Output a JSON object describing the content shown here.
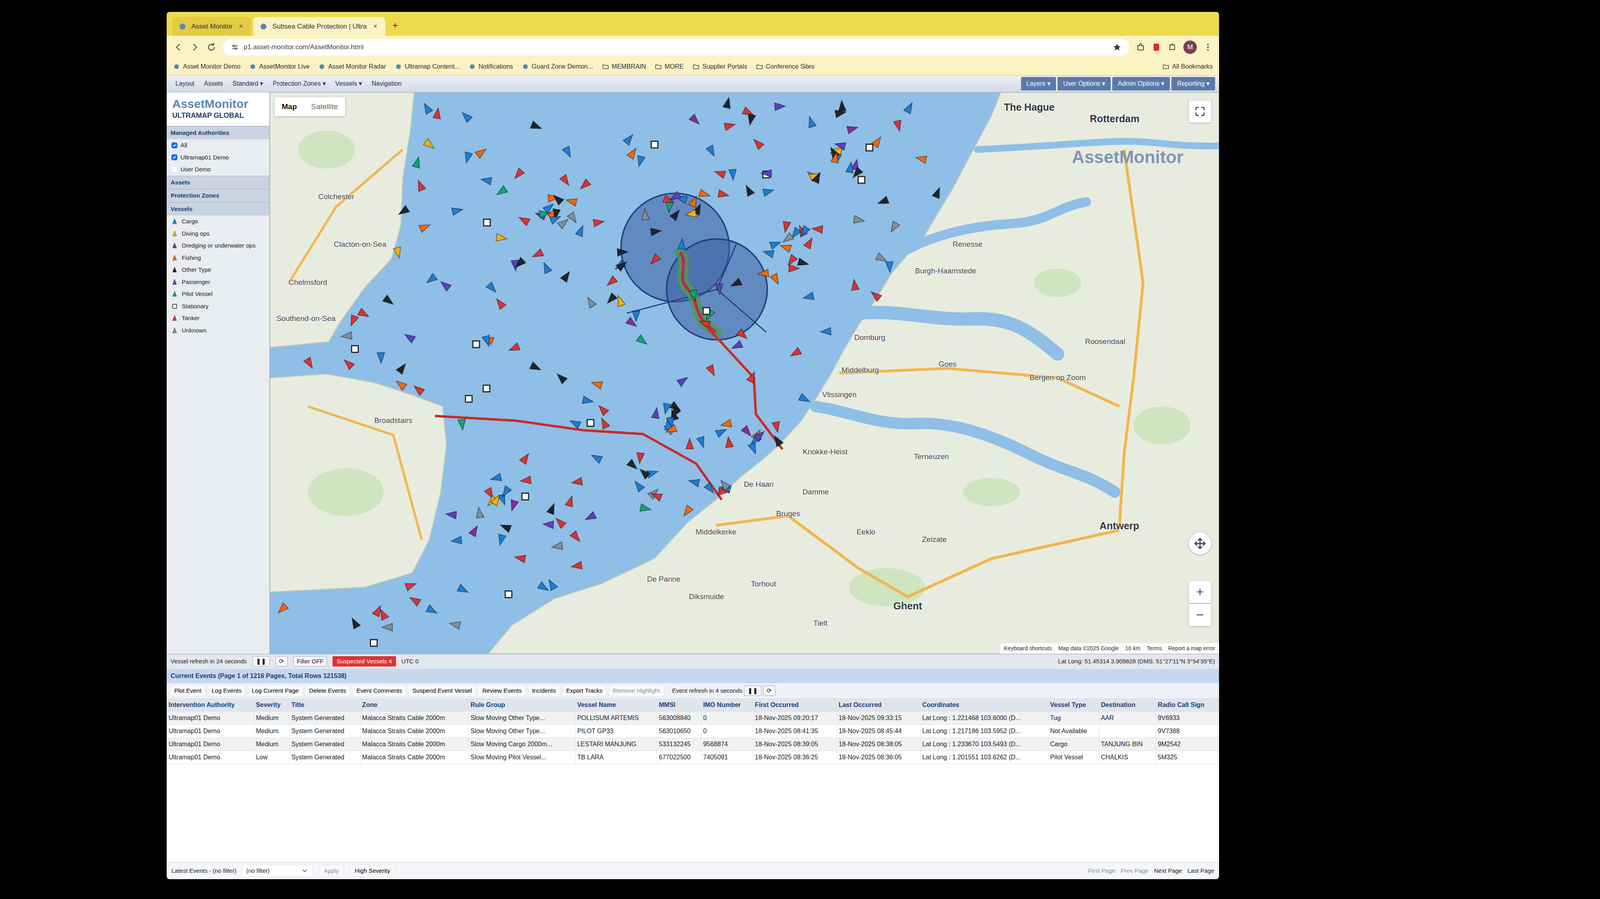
{
  "browser": {
    "tabs": [
      {
        "label": "Asset Monitor",
        "close": "×",
        "selected": false
      },
      {
        "label": "Subsea Cable Protection | Ultra",
        "close": "×",
        "selected": true
      }
    ],
    "new_tab": "+",
    "url": "p1.asset-monitor.com/AssetMonitor.html",
    "profile": "M",
    "bookmarks": [
      {
        "label": "Asset Monitor Demo",
        "kind": "site"
      },
      {
        "label": "AssetMonitor Live",
        "kind": "site"
      },
      {
        "label": "Asset Monitor Radar",
        "kind": "site"
      },
      {
        "label": "Ultramap Content...",
        "kind": "site"
      },
      {
        "label": "Notifications",
        "kind": "site"
      },
      {
        "label": "Guard Zone Demon...",
        "kind": "site"
      },
      {
        "label": "MEMBRAIN",
        "kind": "folder"
      },
      {
        "label": "MORE",
        "kind": "folder"
      },
      {
        "label": "Supplier Portals",
        "kind": "folder"
      },
      {
        "label": "Conference Sites",
        "kind": "folder"
      }
    ],
    "all_bookmarks": "All Bookmarks"
  },
  "app": {
    "logo_main": "AssetMonitor",
    "logo_sub": "ULTRAMAP GLOBAL",
    "menu": [
      "Layout",
      "Assets",
      "Standard ▾",
      "Protection Zones ▾",
      "Vessels ▾",
      "Navigation"
    ],
    "right_menu": [
      "Layers ▾",
      "User Options ▾",
      "Admin Options ▾",
      "Reporting ▾"
    ]
  },
  "sidebar": {
    "sections": [
      {
        "title": "Managed Authorities",
        "items": [
          {
            "label": "All",
            "checked": true
          },
          {
            "label": "Ultramap01 Demo",
            "checked": true
          },
          {
            "label": "User Demo",
            "checked": false
          }
        ]
      },
      {
        "title": "Assets",
        "items": []
      },
      {
        "title": "Protection Zones",
        "items": []
      }
    ],
    "legend_title": "Vessels",
    "legend": [
      {
        "label": "Cargo",
        "color": "#1c7ed6",
        "kind": "arrow"
      },
      {
        "label": "Diving ops",
        "color": "#fab005",
        "kind": "arrow"
      },
      {
        "label": "Dredging or underwater ops",
        "color": "#862e9c",
        "kind": "arrow"
      },
      {
        "label": "Fishing",
        "color": "#f76707",
        "kind": "arrow"
      },
      {
        "label": "Other Type",
        "color": "#212529",
        "kind": "arrow"
      },
      {
        "label": "Passenger",
        "color": "#5f3dc4",
        "kind": "arrow"
      },
      {
        "label": "Pilot Vessel",
        "color": "#0ca678",
        "kind": "arrow"
      },
      {
        "label": "Stationary",
        "color": "#ffffff",
        "kind": "square"
      },
      {
        "label": "Tanker",
        "color": "#e03131",
        "kind": "arrow"
      },
      {
        "label": "Unknown",
        "color": "#868e96",
        "kind": "arrow"
      }
    ]
  },
  "map": {
    "type_buttons": [
      {
        "label": "Map",
        "selected": true
      },
      {
        "label": "Satellite",
        "selected": false
      }
    ],
    "watermark": "AssetMonitor",
    "labels": [
      {
        "text": "The Hague",
        "kind": "city"
      },
      {
        "text": "Rotterdam",
        "kind": "city"
      },
      {
        "text": "Antwerp",
        "kind": "city"
      },
      {
        "text": "Ghent",
        "kind": "city"
      },
      {
        "text": "Bruges",
        "kind": "town"
      },
      {
        "text": "Middelburg",
        "kind": "town"
      },
      {
        "text": "Vlissingen",
        "kind": "town"
      },
      {
        "text": "Goes",
        "kind": "town"
      },
      {
        "text": "Domburg",
        "kind": "town"
      },
      {
        "text": "Burgh-Haamstede",
        "kind": "town"
      },
      {
        "text": "Renesse",
        "kind": "town"
      },
      {
        "text": "Terneuzen",
        "kind": "town"
      },
      {
        "text": "Damme",
        "kind": "town"
      },
      {
        "text": "Eeklo",
        "kind": "town"
      },
      {
        "text": "Zelzate",
        "kind": "town"
      },
      {
        "text": "De Haan",
        "kind": "town"
      },
      {
        "text": "Middelkerke",
        "kind": "town"
      },
      {
        "text": "Knokke-Heist",
        "kind": "town"
      },
      {
        "text": "Torhout",
        "kind": "town"
      },
      {
        "text": "Diksmuide",
        "kind": "town"
      },
      {
        "text": "Tielt",
        "kind": "town"
      },
      {
        "text": "De Panne",
        "kind": "town"
      },
      {
        "text": "Colchester",
        "kind": "town"
      },
      {
        "text": "Clacton-on-Sea",
        "kind": "town"
      },
      {
        "text": "Chelmsford",
        "kind": "town"
      },
      {
        "text": "Southend-on-Sea",
        "kind": "town"
      },
      {
        "text": "Broadstairs",
        "kind": "town"
      },
      {
        "text": "Bergen op Zoom",
        "kind": "town"
      },
      {
        "text": "Roosendaal",
        "kind": "town"
      }
    ],
    "zoom_in": "+",
    "zoom_out": "−",
    "attribution": [
      "Keyboard shortcuts",
      "Map data ©2025 Google",
      "10 km",
      "Terms",
      "Report a map error"
    ]
  },
  "status_bar": {
    "items": [
      {
        "label": "Vessel refresh in 24 seconds",
        "kind": "text"
      },
      {
        "label": "❚❚",
        "kind": "button"
      },
      {
        "label": "⟳",
        "kind": "button"
      },
      {
        "label": "Filter OFF",
        "kind": "button"
      },
      {
        "label": "Suspected Vessels 4",
        "kind": "alert"
      },
      {
        "label": "UTC 0",
        "kind": "text"
      }
    ],
    "lat_long": "Lat Long: 51.45314 3.909828 (DMS: 51°27'11\"N 3°54'35\"E)"
  },
  "events": {
    "title": "Current Events (Page 1 of 1216 Pages, Total Rows 121538)",
    "toolbar": [
      {
        "label": "Plot Event",
        "disabled": false
      },
      {
        "label": "Log Events",
        "disabled": false
      },
      {
        "label": "Log Current Page",
        "disabled": false
      },
      {
        "label": "Delete Events",
        "disabled": false
      },
      {
        "label": "Event Comments",
        "disabled": false
      },
      {
        "label": "Suspend Event Vessel",
        "disabled": false
      },
      {
        "label": "Review Events",
        "disabled": false
      },
      {
        "label": "Incidents",
        "disabled": false
      },
      {
        "label": "Export Tracks",
        "disabled": false
      },
      {
        "label": "Remove Highlight",
        "disabled": true
      }
    ],
    "refresh": "Event refresh in 4 seconds",
    "refresh_controls": [
      "❚❚",
      "⟳"
    ],
    "columns": [
      "Intervention Authority",
      "Severity",
      "Title",
      "Zone",
      "Rule Group",
      "Vessel Name",
      "MMSI",
      "IMO Number",
      "First Occurred",
      "Last Occurred",
      "Coordinates",
      "Vessel Type",
      "Destination",
      "Radio Call Sign"
    ],
    "rows": [
      [
        "Ultramap01 Demo",
        "Medium",
        "System Generated",
        "Malacca Straits Cable 2000m",
        "Slow Moving Other Type...",
        "POLLISUM ARTEMIS",
        "563008840",
        "0",
        "18-Nov-2025 09:20:17",
        "18-Nov-2025 09:33:15",
        "Lat Long : 1.221468 103.6000 (D...",
        "Tug",
        "AAR",
        "9V6933"
      ],
      [
        "Ultramap01 Demo",
        "Medium",
        "System Generated",
        "Malacca Straits Cable 2000m",
        "Slow Moving Other Type...",
        "PILOT GP33",
        "563010650",
        "0",
        "18-Nov-2025 08:41:35",
        "18-Nov-2025 08:45:44",
        "Lat Long : 1.217186 103.5952 (D...",
        "Not Available",
        "",
        "9V7388"
      ],
      [
        "Ultramap01 Demo",
        "Medium",
        "System Generated",
        "Malacca Straits Cable 2000m",
        "Slow Moving Cargo 2000m...",
        "LESTARI MANJUNG",
        "533132245",
        "9568874",
        "18-Nov-2025 08:39:05",
        "18-Nov-2025 08:38:05",
        "Lat Long : 1.233670 103.5493 (D...",
        "Cargo",
        "TANJUNG BIN",
        "9M2542"
      ],
      [
        "Ultramap01 Demo",
        "Low",
        "System Generated",
        "Malacca Straits Cable 2000m",
        "Slow Moving Pilot Vessel...",
        "TB LARA",
        "677022500",
        "7405091",
        "18-Nov-2025 08:36:25",
        "18-Nov-2025 08:36:05",
        "Lat Long : 1.201551 103.6262 (D...",
        "Pilot Vessel",
        "CHALKIS",
        "5M325"
      ]
    ],
    "footer": {
      "label": "Latest Events - (no filter)",
      "filter": "(no filter)",
      "buttons": [
        {
          "label": "Apply",
          "disabled": true
        },
        {
          "label": "High Severity",
          "disabled": false
        }
      ],
      "pages": [
        {
          "label": "First Page",
          "disabled": true
        },
        {
          "label": "Prev Page",
          "disabled": true
        },
        {
          "label": "Next Page",
          "disabled": false
        },
        {
          "label": "Last Page",
          "disabled": false
        }
      ]
    }
  }
}
